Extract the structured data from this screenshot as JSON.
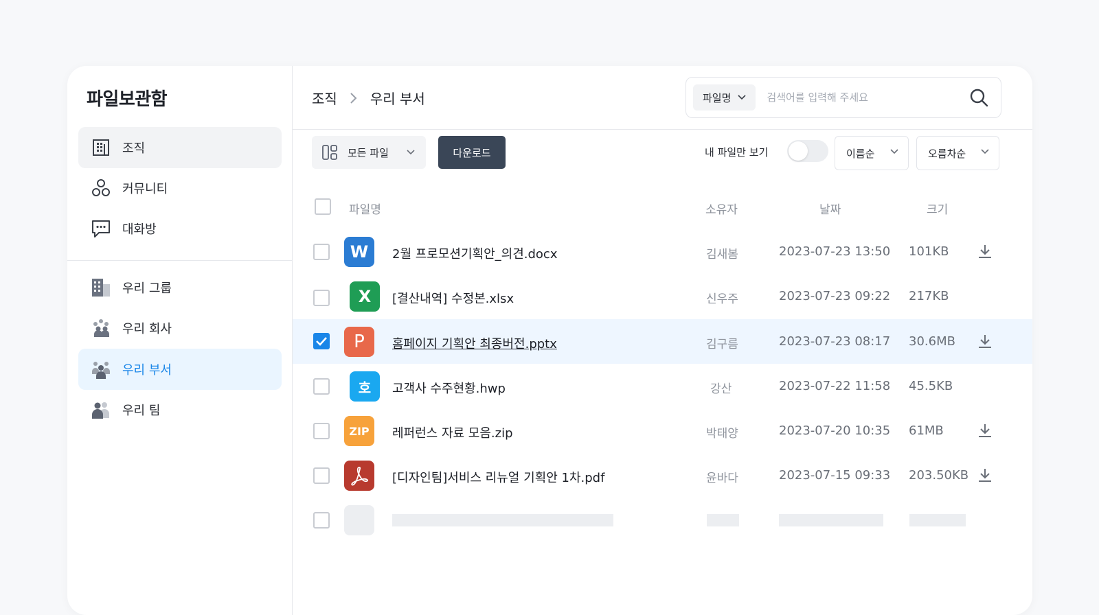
{
  "sidebar": {
    "title": "파일보관함",
    "nav": [
      {
        "label": "조직",
        "icon": "building-icon"
      },
      {
        "label": "커뮤니티",
        "icon": "community-icon"
      },
      {
        "label": "대화방",
        "icon": "chat-icon"
      }
    ],
    "groups": [
      {
        "label": "우리 그룹",
        "icon": "group-building-icon"
      },
      {
        "label": "우리 회사",
        "icon": "company-people-icon"
      },
      {
        "label": "우리 부서",
        "icon": "department-people-icon"
      },
      {
        "label": "우리 팀",
        "icon": "team-people-icon"
      }
    ]
  },
  "breadcrumb": {
    "root": "조직",
    "current": "우리 부서"
  },
  "search": {
    "filter": "파일명",
    "placeholder": "검색어를 입력해 주세요"
  },
  "toolbar": {
    "filter": "모든 파일",
    "download": "다운로드",
    "my_files_label": "내 파일만 보기",
    "my_files_on": false,
    "sort": "이름순",
    "order": "오름차순"
  },
  "table": {
    "headers": {
      "name": "파일명",
      "owner": "소유자",
      "date": "날짜",
      "size": "크기"
    },
    "rows": [
      {
        "icon": "W",
        "type": "word",
        "name": "2월 프로모션기획안_의견.docx",
        "owner": "김새봄",
        "date": "2023-07-23 13:50",
        "size": "101KB",
        "downloadable": true,
        "checked": false
      },
      {
        "icon": "X",
        "type": "excel",
        "name": "[결산내역] 수정본.xlsx",
        "owner": "신우주",
        "date": "2023-07-23 09:22",
        "size": "217KB",
        "downloadable": false,
        "checked": false
      },
      {
        "icon": "P",
        "type": "powerpoint",
        "name": "홈페이지 기획안 최종버전.pptx",
        "owner": "김구름",
        "date": "2023-07-23 08:17",
        "size": "30.6MB",
        "downloadable": true,
        "checked": true
      },
      {
        "icon": "호",
        "type": "hwp",
        "name": "고객사 수주현황.hwp",
        "owner": "강산",
        "date": "2023-07-22 11:58",
        "size": "45.5KB",
        "downloadable": false,
        "checked": false
      },
      {
        "icon": "ZIP",
        "type": "zip",
        "name": "레퍼런스 자료 모음.zip",
        "owner": "박태양",
        "date": "2023-07-20 10:35",
        "size": "61MB",
        "downloadable": true,
        "checked": false
      },
      {
        "icon": "pdf",
        "type": "pdf",
        "name": "[디자인팀]서비스 리뉴얼 기획안 1차.pdf",
        "owner": "윤바다",
        "date": "2023-07-15 09:33",
        "size": "203.50KB",
        "downloadable": true,
        "checked": false
      }
    ]
  },
  "colors": {
    "accent": "#1a86e8",
    "dark_button": "#3a4657",
    "word": "#2b7cd3",
    "excel": "#1f9d55",
    "powerpoint": "#e8684a",
    "hwp": "#1aa8f0",
    "zip": "#f7a23b",
    "pdf": "#b83a2e"
  }
}
